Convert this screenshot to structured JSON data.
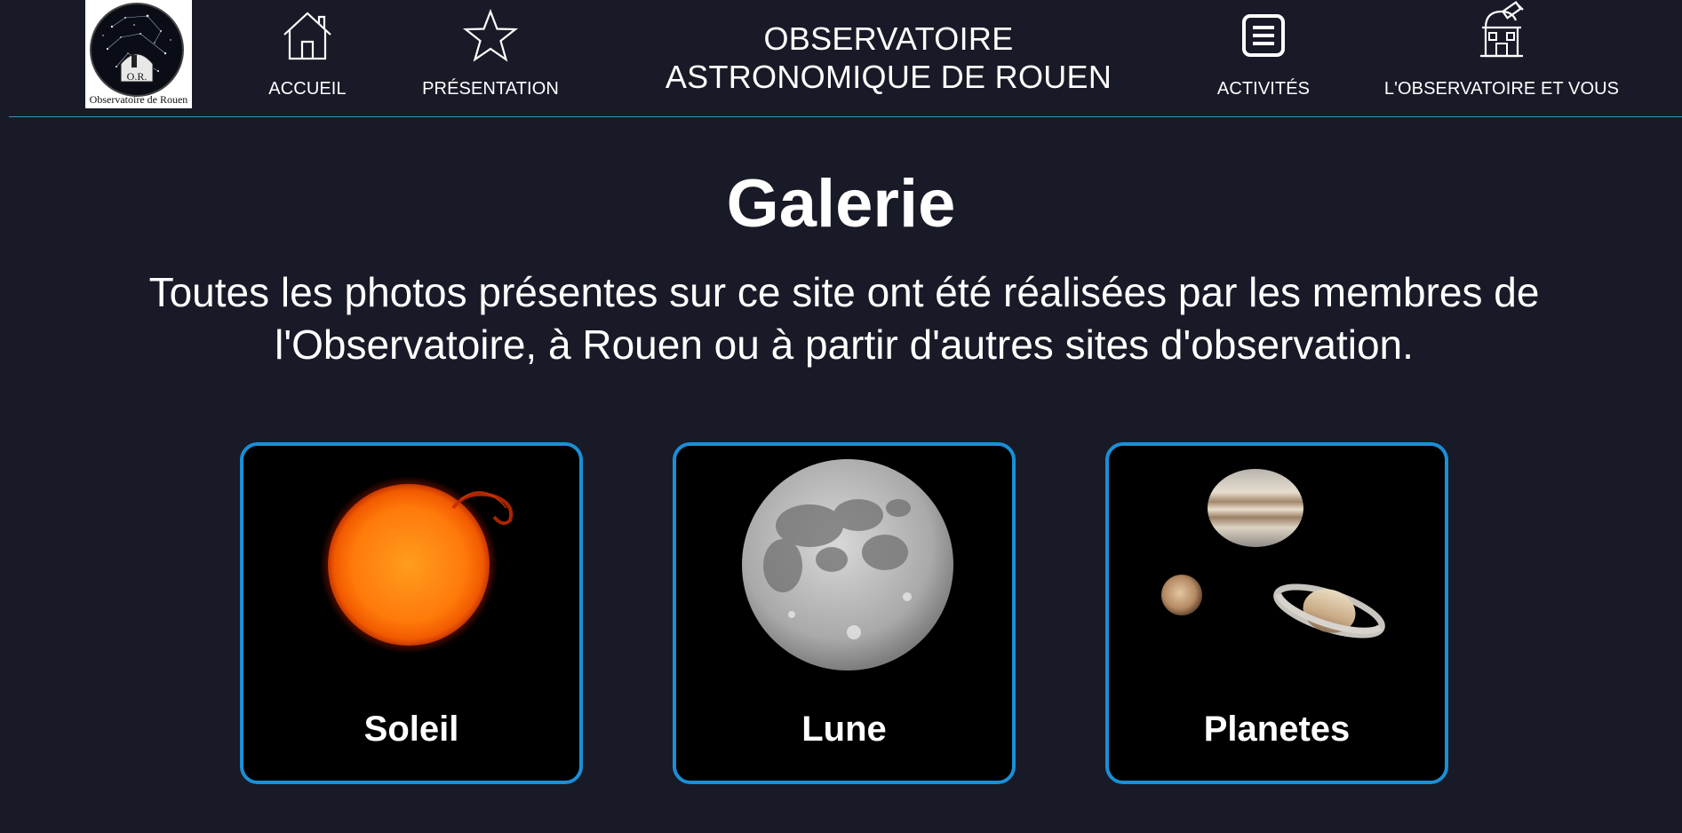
{
  "header": {
    "logo": {
      "monogram": "O.R.",
      "caption": "Observatoire de Rouen",
      "icon": "observatory-logo"
    },
    "title_line1": "OBSERVATOIRE",
    "title_line2": "ASTRONOMIQUE DE ROUEN",
    "nav": [
      {
        "label": "ACCUEIL",
        "icon": "home-icon"
      },
      {
        "label": "PRÉSENTATION",
        "icon": "star-icon"
      },
      {
        "label": "ACTIVITÉS",
        "icon": "list-icon"
      },
      {
        "label": "L'OBSERVATOIRE ET VOUS",
        "icon": "observatory-icon"
      }
    ],
    "accent_color": "#3a93c4"
  },
  "main": {
    "title": "Galerie",
    "intro": "Toutes les photos présentes sur ce site ont été réalisées par les membres de l'Observatoire, à Rouen ou à partir d'autres sites d'observation.",
    "cards": [
      {
        "label": "Soleil",
        "image": "sun-photo"
      },
      {
        "label": "Lune",
        "image": "moon-photo"
      },
      {
        "label": "Planetes",
        "image": "planets-photo"
      }
    ],
    "card_border_color": "#1b8fd6",
    "background_color": "#191a27"
  }
}
